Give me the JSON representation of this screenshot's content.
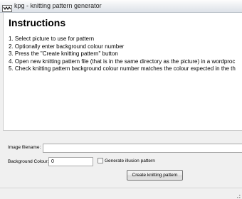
{
  "window": {
    "title": "kpg - knitting pattern generator",
    "app_icon": "knitting-app-icon"
  },
  "instructions": {
    "heading": "Instructions",
    "steps": [
      "1. Select picture to use for pattern",
      "2. Optionally enter background colour number",
      "3. Press the \"Create knitting pattern\" button",
      "4. Open new knitting pattern file (that is in the same directory as the picture) in a wordproc",
      "5. Check knitting pattern background colour number matches the colour expected in the th"
    ]
  },
  "form": {
    "image_filename_label": "Image filename:",
    "image_filename_value": "",
    "background_colour_label": "Background Colour:",
    "background_colour_value": "0",
    "illusion_checkbox_label": "Generate illusion pattern",
    "illusion_checked": false,
    "create_button_label": "Create knitting pattern"
  },
  "statusbar": {
    "grip_icon": "resize-grip-icon"
  },
  "colors": {
    "window_background": "#f0f0f0",
    "panel_background": "#ffffff",
    "titlebar": "#e6eaee"
  }
}
